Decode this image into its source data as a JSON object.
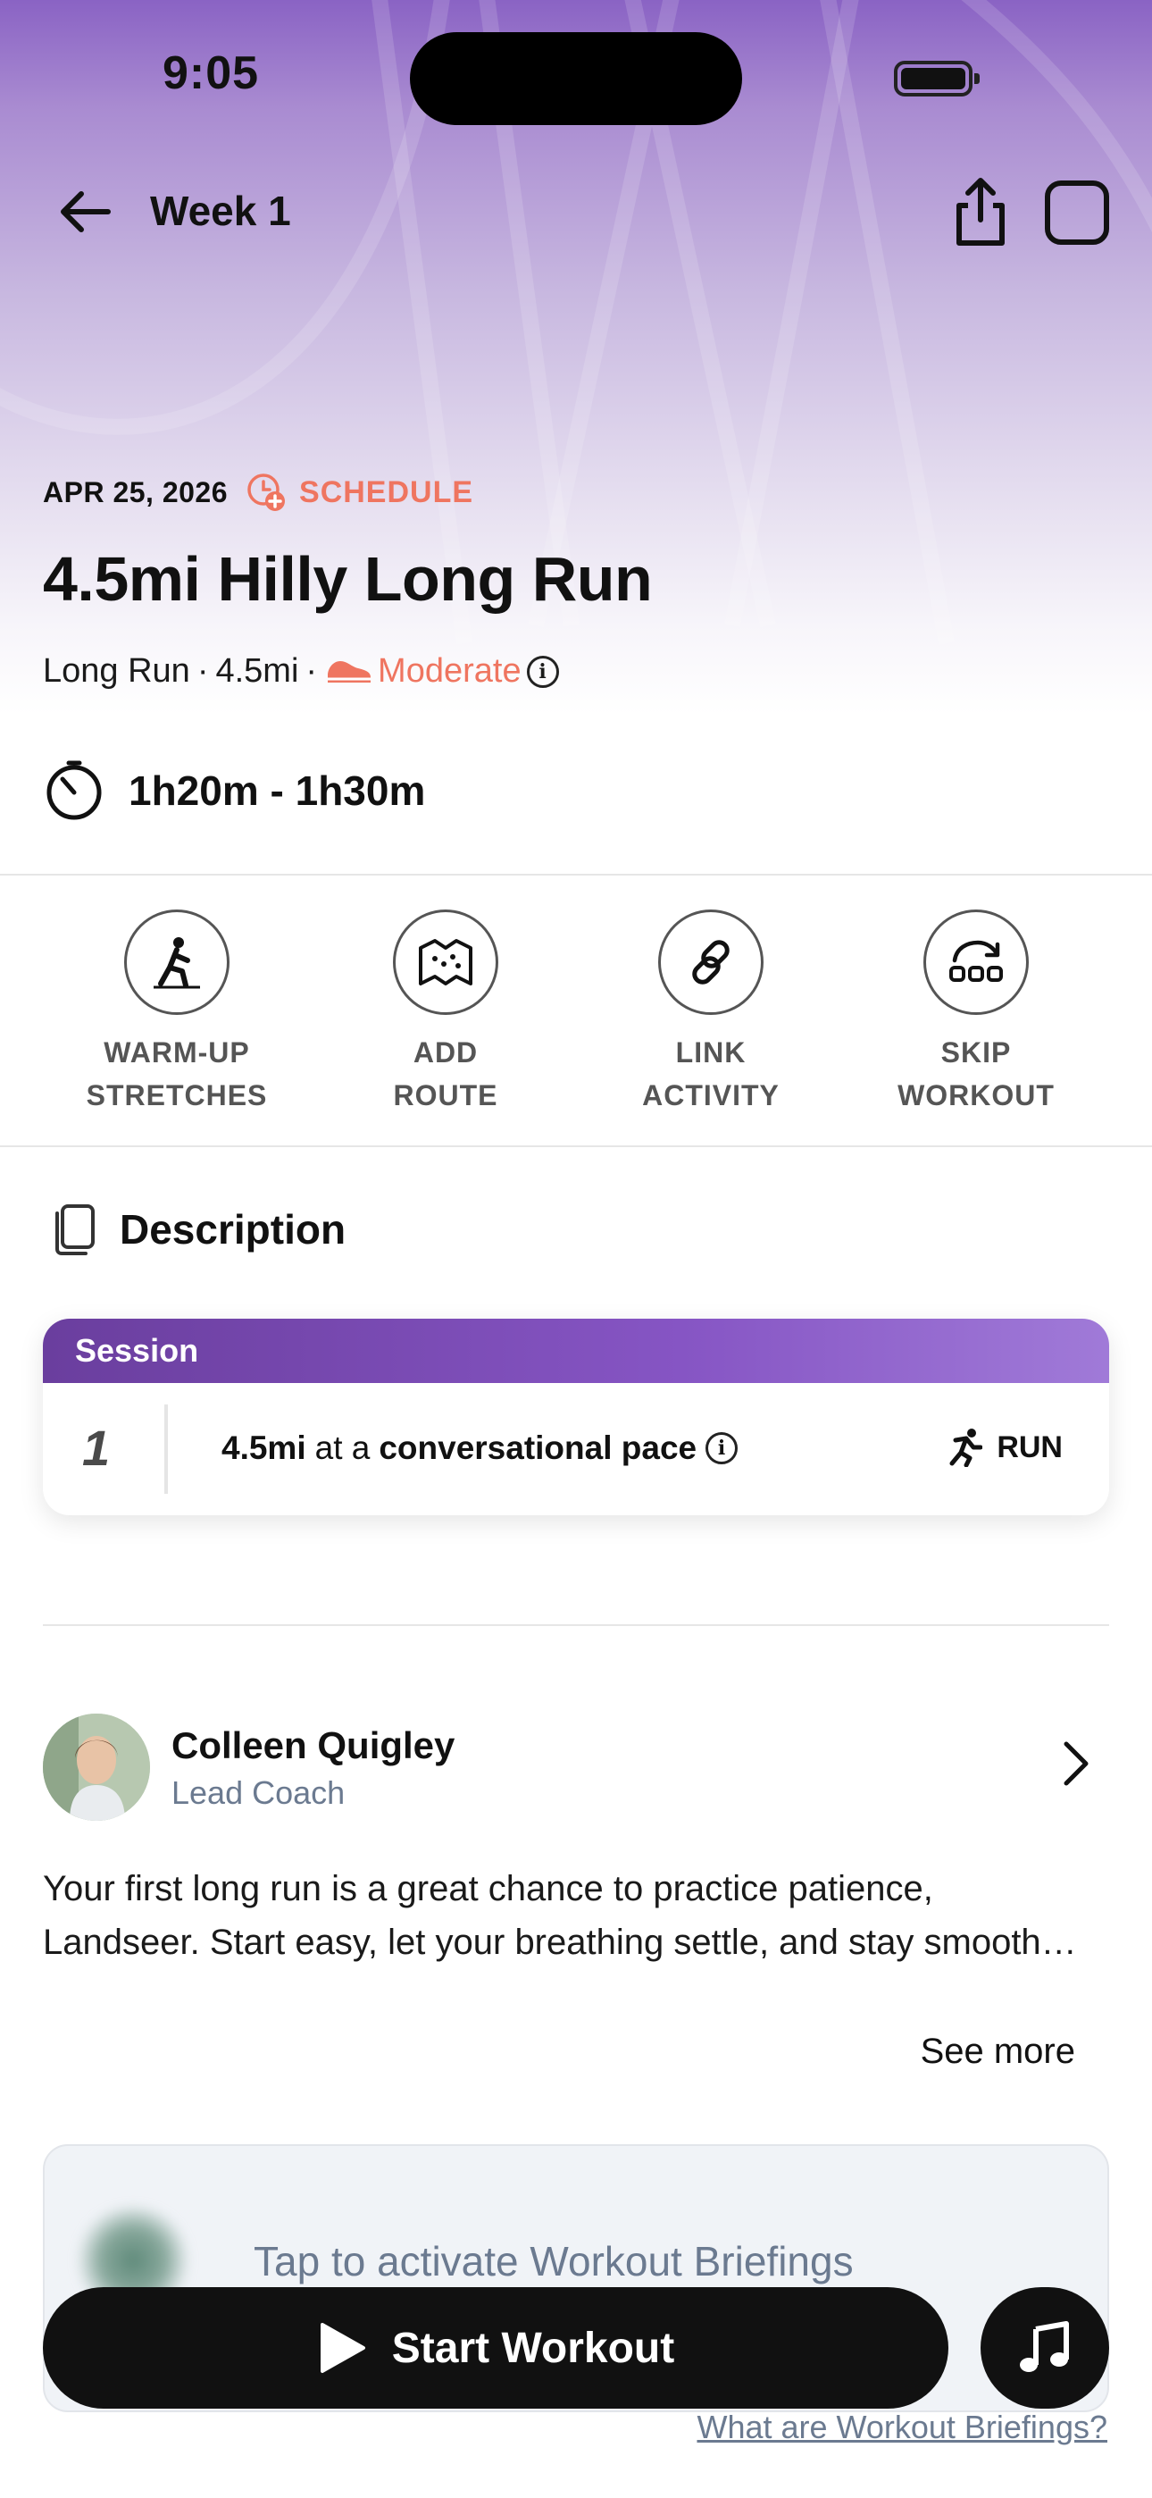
{
  "status_bar": {
    "time": "9:05"
  },
  "nav": {
    "title": "Week 1"
  },
  "workout": {
    "date": "APR 25, 2026",
    "schedule_label": "SCHEDULE",
    "title": "4.5mi Hilly Long Run",
    "type": "Long Run",
    "distance": "4.5mi",
    "intensity": "Moderate",
    "duration": "1h20m - 1h30m",
    "accent_color": "#ef7560"
  },
  "actions": [
    {
      "line1": "WARM-UP",
      "line2": "STRETCHES",
      "icon": "stretch-icon"
    },
    {
      "line1": "ADD",
      "line2": "ROUTE",
      "icon": "map-icon"
    },
    {
      "line1": "LINK",
      "line2": "ACTIVITY",
      "icon": "link-icon"
    },
    {
      "line1": "SKIP",
      "line2": "WORKOUT",
      "icon": "skip-icon"
    }
  ],
  "description": {
    "heading": "Description",
    "session_label": "Session",
    "steps": [
      {
        "number": "1",
        "distance": "4.5mi",
        "connector": "at a",
        "pace": "conversational pace",
        "activity": "RUN"
      }
    ]
  },
  "coach": {
    "name": "Colleen Quigley",
    "role": "Lead Coach",
    "message_line1": "Your first long run is a great chance to practice patience,",
    "message_line2": "Landseer. Start easy, let your breathing settle, and stay smooth…",
    "see_more": "See more"
  },
  "briefing": {
    "prompt": "Tap to activate Workout Briefings",
    "link": "What are Workout Briefings?"
  },
  "start_button": {
    "label": "Start Workout"
  },
  "colors": {
    "brand_purple": "#8655c4",
    "button_dark": "#111111"
  }
}
